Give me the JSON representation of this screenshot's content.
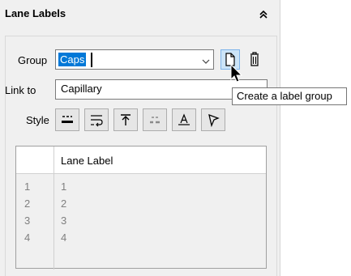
{
  "header": {
    "title": "Lane Labels",
    "collapse_icon": "double-chevron-up-icon"
  },
  "form": {
    "group_label": "Group",
    "group_value": "Caps",
    "link_label": "Link to",
    "link_value": "Capillary",
    "style_label": "Style"
  },
  "style_buttons": [
    {
      "icon": "style-underline-icon"
    },
    {
      "icon": "style-wrap-icon"
    },
    {
      "icon": "style-align-top-icon"
    },
    {
      "icon": "style-dashed-icon"
    },
    {
      "icon": "style-text-frame-icon"
    },
    {
      "icon": "style-pointer-flag-icon"
    }
  ],
  "table": {
    "column_header": "Lane Label",
    "rows": [
      {
        "num": "1",
        "label": "1"
      },
      {
        "num": "2",
        "label": "2"
      },
      {
        "num": "3",
        "label": "3"
      },
      {
        "num": "4",
        "label": "4"
      }
    ]
  },
  "tooltip": {
    "text": "Create a label group"
  },
  "colors": {
    "accent": "#0078d7",
    "panel": "#f0f0f0",
    "selection_text": "#ffffff"
  }
}
